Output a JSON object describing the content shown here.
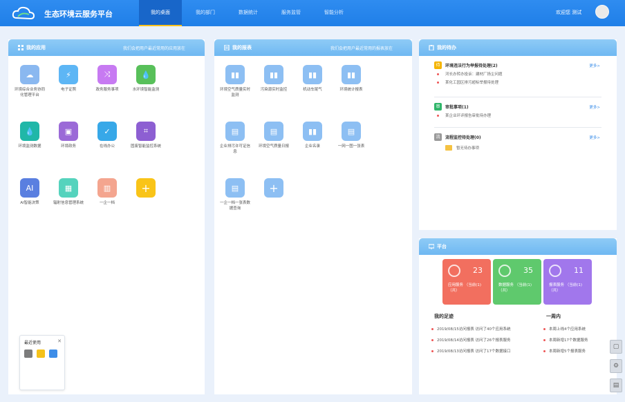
{
  "app": {
    "title": "生态环境云服务平台"
  },
  "nav": {
    "tabs": [
      {
        "label": "我的桌面",
        "active": true
      },
      {
        "label": "我的部门"
      },
      {
        "label": "数据统计"
      },
      {
        "label": "服务监管"
      },
      {
        "label": "智能分析"
      }
    ]
  },
  "user": {
    "name": "欢迎您 测试"
  },
  "apps_panel": {
    "title": "我的应用",
    "tip": "我们会把用户最近常用的应用放在",
    "tiles": [
      {
        "label": "环境综合业务协同化管理平台",
        "icon": "cloud-icon",
        "color": "#8ab8f0"
      },
      {
        "label": "电子证照",
        "icon": "lightning-icon",
        "color": "#5db6f5"
      },
      {
        "label": "政务服务事项",
        "icon": "shuffle-icon",
        "color": "#c77af2"
      },
      {
        "label": "水环境智能监测",
        "icon": "water-drop-icon",
        "color": "#58c05a"
      },
      {
        "label": "环境监测数据",
        "icon": "water-drop-icon",
        "color": "#20b7a8"
      },
      {
        "label": "环境政务",
        "icon": "briefcase-icon",
        "color": "#9b6ad7"
      },
      {
        "label": "在线办公",
        "icon": "clipboard-icon",
        "color": "#37a8e8"
      },
      {
        "label": "固废智能监控系统",
        "icon": "scan-icon",
        "color": "#8d5fd2"
      },
      {
        "label": "AI智能决策",
        "icon": "ai-icon",
        "color": "#5a7fe0"
      },
      {
        "label": "辐射信息管理系统",
        "icon": "grid-icon",
        "color": "#55d3bd"
      },
      {
        "label": "一企一档",
        "icon": "columns-icon",
        "color": "#f4a58f"
      },
      {
        "label": "",
        "icon": "plus-icon",
        "color": "#f9c418"
      }
    ],
    "recent": {
      "title": "最近使用",
      "icons": [
        "gray-app-icon",
        "yellow-app-icon",
        "blue-app-icon"
      ]
    }
  },
  "reports_panel": {
    "title": "我的报表",
    "tip": "我们会把用户最近常用的报表放在",
    "tiles": [
      {
        "label": "环境空气质量实时监测",
        "icon": "bar-chart-icon"
      },
      {
        "label": "污染源实时监控",
        "icon": "bar-chart-icon"
      },
      {
        "label": "机动车尾气",
        "icon": "bar-chart-icon"
      },
      {
        "label": "环境统计报表",
        "icon": "bar-chart-icon"
      },
      {
        "label": "企业排污许可证信息",
        "icon": "document-icon"
      },
      {
        "label": "环境空气质量日报",
        "icon": "document-icon"
      },
      {
        "label": "企业名录",
        "icon": "bar-chart-icon"
      },
      {
        "label": "一网一图一张表",
        "icon": "document-icon"
      },
      {
        "label": "一企一档一张表数据查询",
        "icon": "document-icon"
      },
      {
        "label": "",
        "icon": "plus-icon"
      }
    ]
  },
  "todo_panel": {
    "title": "我的待办",
    "groups": [
      {
        "badge": "待",
        "badge_color": "#f5b400",
        "title": "环境违法行为举报待处理(2)",
        "more": "更多>",
        "items": [
          "河长办转办投诉：建材厂扬尘问题",
          "某化工园区排污超标举报待处理"
        ]
      },
      {
        "badge": "审",
        "badge_color": "#30b66a",
        "title": "审批事项(1)",
        "more": "更多>",
        "items": [
          "某企业环评报告审批待办理"
        ]
      },
      {
        "badge": "流",
        "badge_color": "#999999",
        "title": "流程监控待处理(0)",
        "more": "更多>",
        "items": [
          "暂无待办事项"
        ]
      }
    ]
  },
  "platform_panel": {
    "title": "平台",
    "cards": [
      {
        "count": "23",
        "caption": "应用服务 （当前(1)  （共）",
        "color": "#f26f5f",
        "icon": "cube-icon"
      },
      {
        "count": "35",
        "caption": "数据服务 （当前(1)  （共）",
        "color": "#5fc96d",
        "icon": "refresh-icon"
      },
      {
        "count": "11",
        "caption": "报表服务 （当前(1)  （共）",
        "color": "#a177ec",
        "icon": "report-icon"
      }
    ],
    "log_left": {
      "title": "我的足迹",
      "items": [
        "2019/08/15访问报表 访问了40个应用系统",
        "2019/08/14访问报表 访问了26个报表服务",
        "2019/08/13访问报表 访问了17个数据接口"
      ]
    },
    "log_right": {
      "title": "一周内",
      "items": [
        "本周上线4个应用系统",
        "本周新增17个数据服务",
        "本周新增5个报表服务"
      ]
    }
  },
  "side_tools": [
    "cube-icon",
    "settings-icon",
    "chat-icon"
  ]
}
